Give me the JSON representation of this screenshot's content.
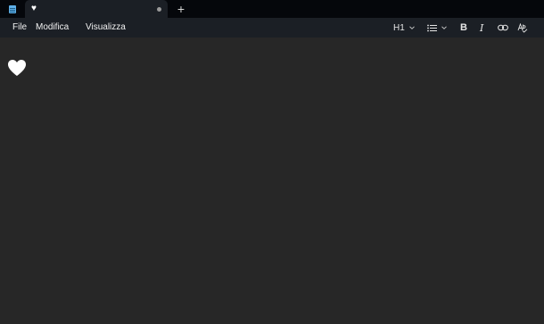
{
  "app": {
    "icon": "notepad-icon",
    "tab": {
      "title": "♥",
      "unsaved_indicator": "dot-icon"
    },
    "new_tab_label": "+"
  },
  "menu": {
    "file": "File",
    "edit": "Modifica",
    "view": "Visualizza"
  },
  "toolbar": {
    "heading_label": "H1",
    "list_icon": "bulleted-list-icon",
    "bold_label": "B",
    "italic_label": "I",
    "link_icon": "link-icon",
    "spellcheck_icon": "spellcheck-icon"
  },
  "editor": {
    "content": "♥"
  },
  "colors": {
    "titlebar": "#05070b",
    "toolbar": "#1b1f25",
    "editor_bg": "#272727",
    "text": "#ffffff"
  }
}
